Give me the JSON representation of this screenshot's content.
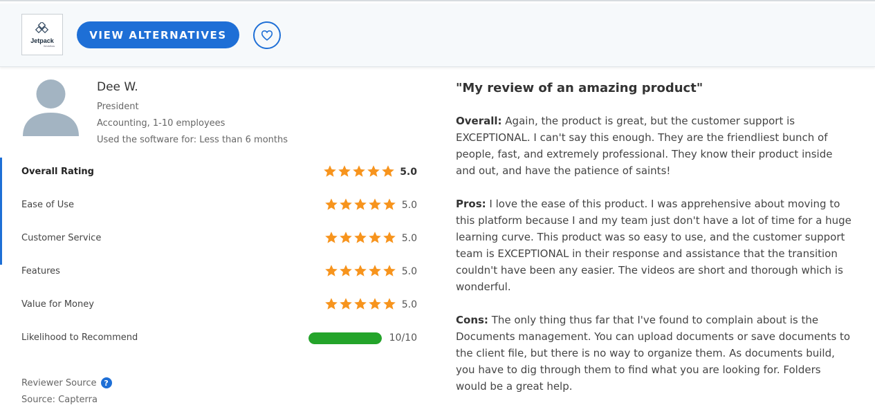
{
  "header": {
    "logo_text": "Jetpack",
    "logo_sub": "Workflow",
    "view_alternatives_label": "VIEW ALTERNATIVES"
  },
  "reviewer": {
    "name": "Dee W.",
    "title": "President",
    "industry": "Accounting, 1-10 employees",
    "usage": "Used the software for: Less than 6 months"
  },
  "ratings": [
    {
      "label": "Overall Rating",
      "value": "5.0",
      "stars": 5
    },
    {
      "label": "Ease of Use",
      "value": "5.0",
      "stars": 5
    },
    {
      "label": "Customer Service",
      "value": "5.0",
      "stars": 5
    },
    {
      "label": "Features",
      "value": "5.0",
      "stars": 5
    },
    {
      "label": "Value for Money",
      "value": "5.0",
      "stars": 5
    }
  ],
  "recommend": {
    "label": "Likelihood to Recommend",
    "value": "10/10",
    "fraction": 1.0
  },
  "source": {
    "label": "Reviewer Source",
    "cut_label": "Source: Capterra"
  },
  "review": {
    "title": "\"My review of an amazing product\"",
    "overall_label": "Overall:",
    "overall_text": "Again, the product is great, but the customer support is EXCEPTIONAL. I can't say this enough. They are the friendliest bunch of people, fast, and extremely professional. They know their product inside and out, and have the patience of saints!",
    "pros_label": "Pros:",
    "pros_text": "I love the ease of this product. I was apprehensive about moving to this platform because I and my team just don't have a lot of time for a huge learning curve. This product was so easy to use, and the customer support team is EXCEPTIONAL in their response and assistance that the transition couldn't have been any easier. The videos are short and thorough which is wonderful.",
    "cons_label": "Cons:",
    "cons_text": "The only thing thus far that I've found to complain about is the Documents management. You can upload documents or save documents to the client file, but there is no way to organize them. As documents build, you have to dig through them to find what you are looking for. Folders would be a great help."
  },
  "colors": {
    "accent": "#1e6fd6",
    "star": "#f7941d",
    "progress": "#24a42a"
  }
}
